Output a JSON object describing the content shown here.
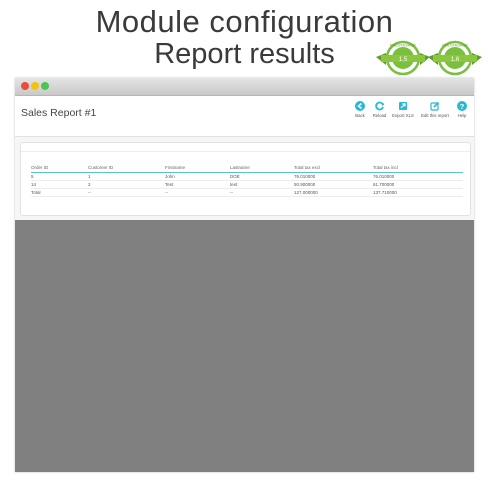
{
  "hero": {
    "title": "Module configuration",
    "subtitle": "Report results"
  },
  "badges": [
    {
      "brand": "PRESTASHOP",
      "version": "1.5",
      "color": "#7bbf3e"
    },
    {
      "brand": "PRESTASHOP",
      "version": "1.6",
      "color": "#7bbf3e"
    }
  ],
  "report": {
    "title": "Sales Report #1"
  },
  "toolbar": {
    "back": "Back",
    "reload": "Reload",
    "export": "Export XLS",
    "edit": "Edit this report",
    "help": "Help",
    "accent": "#25b9d7"
  },
  "table": {
    "headers": [
      "Order ID",
      "Customer ID",
      "Firstname",
      "Lastname",
      "Total tax excl",
      "Total tax incl"
    ],
    "rows": [
      [
        "5",
        "1",
        "John",
        "DOE",
        "76.010000",
        "76.010000"
      ],
      [
        "14",
        "2",
        "Test",
        "test",
        "50.900000",
        "61.700000"
      ],
      [
        "Total",
        "--",
        "--",
        "--",
        "127.000000",
        "137.710000"
      ]
    ]
  }
}
